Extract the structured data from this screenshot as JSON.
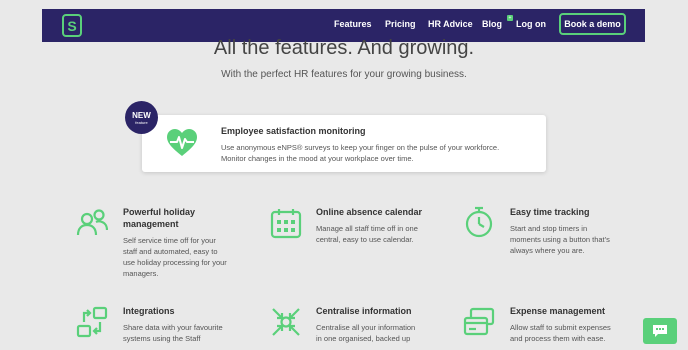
{
  "nav": {
    "logo_letter": "S",
    "links": [
      "Features",
      "Pricing",
      "HR Advice",
      "Blog",
      "Log on"
    ],
    "badge": "+",
    "cta": "Book a demo"
  },
  "hero": {
    "title": "All the features. And growing.",
    "subtitle": "With the perfect HR features for your growing business."
  },
  "highlight": {
    "badge_main": "NEW",
    "badge_sub": "feature",
    "title": "Employee satisfaction monitoring",
    "desc_lines": [
      "Use anonymous eNPS® surveys to keep your finger on the pulse of your workforce.",
      "Monitor changes in the mood at your workplace over time."
    ]
  },
  "features": [
    {
      "icon": "users-icon",
      "title_lines": [
        "Powerful holiday",
        "management"
      ],
      "desc_lines": [
        "Self service time off for your",
        "staff and automated, easy to",
        "use holiday processing for your",
        "managers."
      ]
    },
    {
      "icon": "calendar-icon",
      "title_lines": [
        "Online absence calendar"
      ],
      "desc_lines": [
        "Manage all staff time off in one",
        "central, easy to use calendar."
      ]
    },
    {
      "icon": "timer-icon",
      "title_lines": [
        "Easy time tracking"
      ],
      "desc_lines": [
        "Start and stop timers in",
        "moments using a button that's",
        "always where you are."
      ]
    },
    {
      "icon": "integrations-icon",
      "title_lines": [
        "Integrations"
      ],
      "desc_lines": [
        "Share data with your favourite",
        "systems using the Staff"
      ]
    },
    {
      "icon": "centralise-icon",
      "title_lines": [
        "Centralise information"
      ],
      "desc_lines": [
        "Centralise all your information",
        "in one organised, backed up"
      ]
    },
    {
      "icon": "card-icon",
      "title_lines": [
        "Expense management"
      ],
      "desc_lines": [
        "Allow staff to submit expenses",
        "and process them with ease."
      ]
    }
  ],
  "colors": {
    "navy": "#2b2466",
    "green": "#5ad07a",
    "background": "#e9e9e9"
  }
}
